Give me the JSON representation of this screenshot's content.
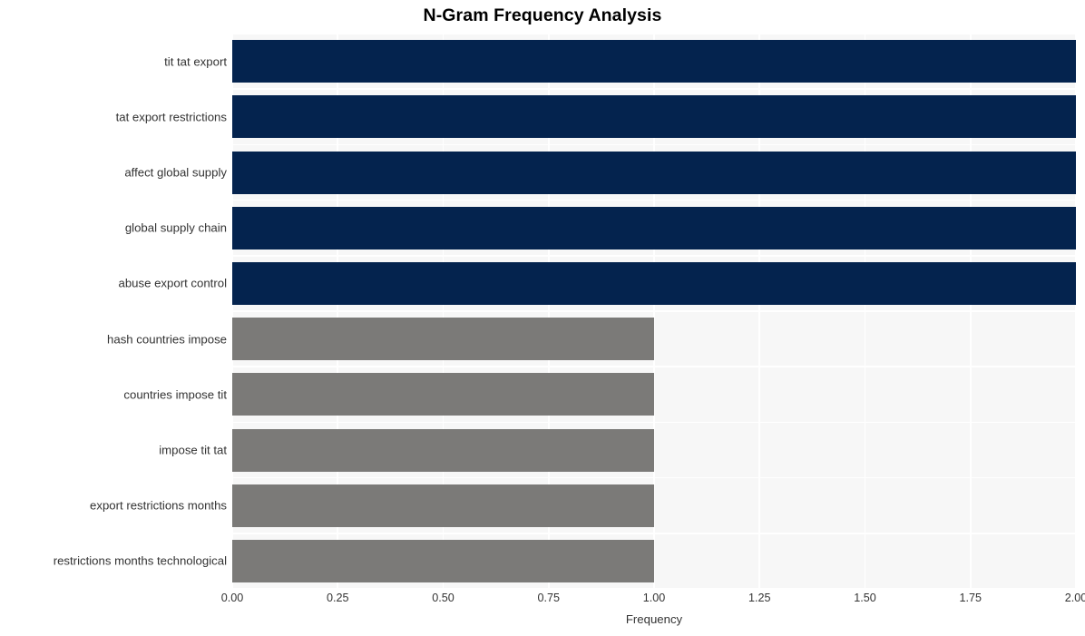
{
  "chart_data": {
    "type": "bar",
    "orientation": "horizontal",
    "title": "N-Gram Frequency Analysis",
    "xlabel": "Frequency",
    "ylabel": "",
    "xlim": [
      0.0,
      2.0
    ],
    "xticks": [
      "0.00",
      "0.25",
      "0.50",
      "0.75",
      "1.00",
      "1.25",
      "1.50",
      "1.75",
      "2.00"
    ],
    "xtick_values": [
      0.0,
      0.25,
      0.5,
      0.75,
      1.0,
      1.25,
      1.5,
      1.75,
      2.0
    ],
    "grid": true,
    "legend": null,
    "categories": [
      "tit tat export",
      "tat export restrictions",
      "affect global supply",
      "global supply chain",
      "abuse export control",
      "hash countries impose",
      "countries impose tit",
      "impose tit tat",
      "export restrictions months",
      "restrictions months technological"
    ],
    "values": [
      2,
      2,
      2,
      2,
      2,
      1,
      1,
      1,
      1,
      1
    ],
    "bar_colors": [
      "#04234e",
      "#04234e",
      "#04234e",
      "#04234e",
      "#04234e",
      "#7b7a78",
      "#7b7a78",
      "#7b7a78",
      "#7b7a78",
      "#7b7a78"
    ]
  },
  "style": {
    "plot_background": "#f7f7f7",
    "figure_background": "#ffffff",
    "gridline_color": "#ffffff",
    "tick_label_color": "#333333",
    "title_color": "#000000",
    "color_high": "#04234e",
    "color_low": "#7b7a78"
  }
}
